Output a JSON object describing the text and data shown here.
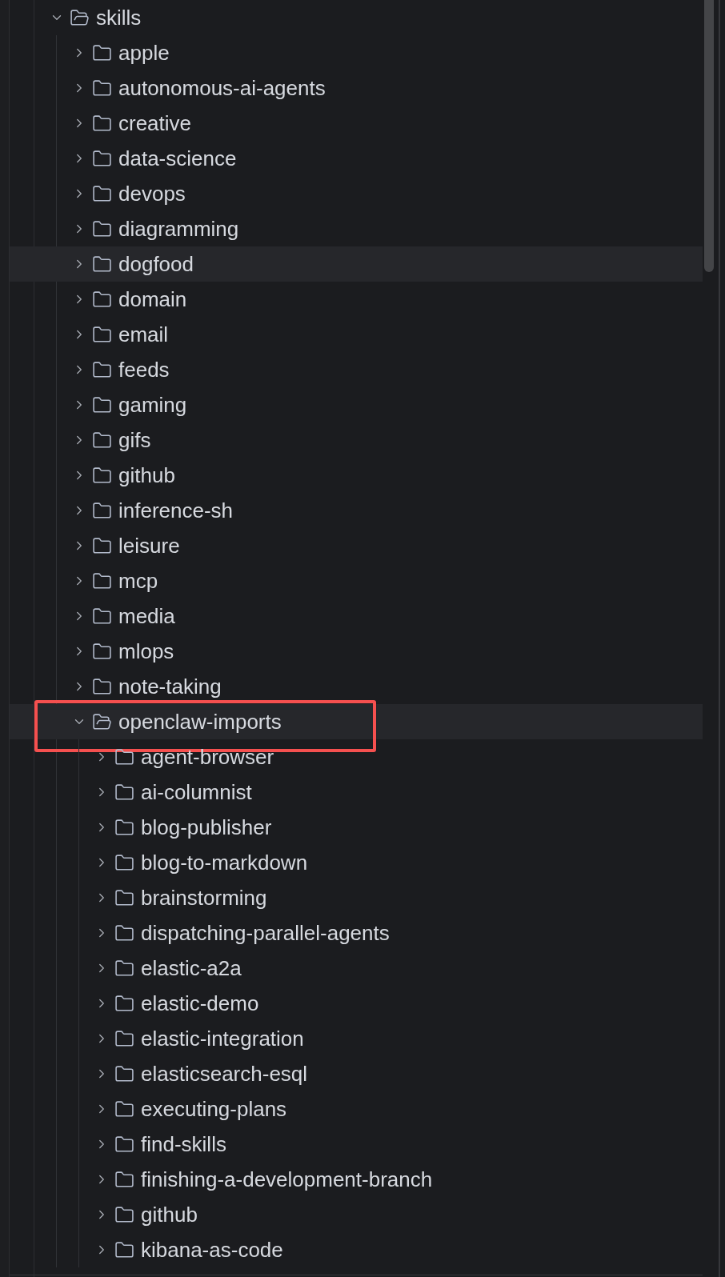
{
  "tree": [
    {
      "name": "skills",
      "expanded": true,
      "highlighted": false,
      "marked": false,
      "children": [
        {
          "name": "apple",
          "expanded": false,
          "highlighted": false,
          "marked": false
        },
        {
          "name": "autonomous-ai-agents",
          "expanded": false,
          "highlighted": false,
          "marked": false
        },
        {
          "name": "creative",
          "expanded": false,
          "highlighted": false,
          "marked": false
        },
        {
          "name": "data-science",
          "expanded": false,
          "highlighted": false,
          "marked": false
        },
        {
          "name": "devops",
          "expanded": false,
          "highlighted": false,
          "marked": false
        },
        {
          "name": "diagramming",
          "expanded": false,
          "highlighted": false,
          "marked": false
        },
        {
          "name": "dogfood",
          "expanded": false,
          "highlighted": true,
          "marked": false
        },
        {
          "name": "domain",
          "expanded": false,
          "highlighted": false,
          "marked": false
        },
        {
          "name": "email",
          "expanded": false,
          "highlighted": false,
          "marked": false
        },
        {
          "name": "feeds",
          "expanded": false,
          "highlighted": false,
          "marked": false
        },
        {
          "name": "gaming",
          "expanded": false,
          "highlighted": false,
          "marked": false
        },
        {
          "name": "gifs",
          "expanded": false,
          "highlighted": false,
          "marked": false
        },
        {
          "name": "github",
          "expanded": false,
          "highlighted": false,
          "marked": false
        },
        {
          "name": "inference-sh",
          "expanded": false,
          "highlighted": false,
          "marked": false
        },
        {
          "name": "leisure",
          "expanded": false,
          "highlighted": false,
          "marked": false
        },
        {
          "name": "mcp",
          "expanded": false,
          "highlighted": false,
          "marked": false
        },
        {
          "name": "media",
          "expanded": false,
          "highlighted": false,
          "marked": false
        },
        {
          "name": "mlops",
          "expanded": false,
          "highlighted": false,
          "marked": false
        },
        {
          "name": "note-taking",
          "expanded": false,
          "highlighted": false,
          "marked": false
        },
        {
          "name": "openclaw-imports",
          "expanded": true,
          "highlighted": true,
          "marked": true,
          "children": [
            {
              "name": "agent-browser",
              "expanded": false,
              "highlighted": false,
              "marked": false
            },
            {
              "name": "ai-columnist",
              "expanded": false,
              "highlighted": false,
              "marked": false
            },
            {
              "name": "blog-publisher",
              "expanded": false,
              "highlighted": false,
              "marked": false
            },
            {
              "name": "blog-to-markdown",
              "expanded": false,
              "highlighted": false,
              "marked": false
            },
            {
              "name": "brainstorming",
              "expanded": false,
              "highlighted": false,
              "marked": false
            },
            {
              "name": "dispatching-parallel-agents",
              "expanded": false,
              "highlighted": false,
              "marked": false
            },
            {
              "name": "elastic-a2a",
              "expanded": false,
              "highlighted": false,
              "marked": false
            },
            {
              "name": "elastic-demo",
              "expanded": false,
              "highlighted": false,
              "marked": false
            },
            {
              "name": "elastic-integration",
              "expanded": false,
              "highlighted": false,
              "marked": false
            },
            {
              "name": "elasticsearch-esql",
              "expanded": false,
              "highlighted": false,
              "marked": false
            },
            {
              "name": "executing-plans",
              "expanded": false,
              "highlighted": false,
              "marked": false
            },
            {
              "name": "find-skills",
              "expanded": false,
              "highlighted": false,
              "marked": false
            },
            {
              "name": "finishing-a-development-branch",
              "expanded": false,
              "highlighted": false,
              "marked": false
            },
            {
              "name": "github",
              "expanded": false,
              "highlighted": false,
              "marked": false
            },
            {
              "name": "kibana-as-code",
              "expanded": false,
              "highlighted": false,
              "marked": false
            }
          ]
        }
      ]
    }
  ]
}
